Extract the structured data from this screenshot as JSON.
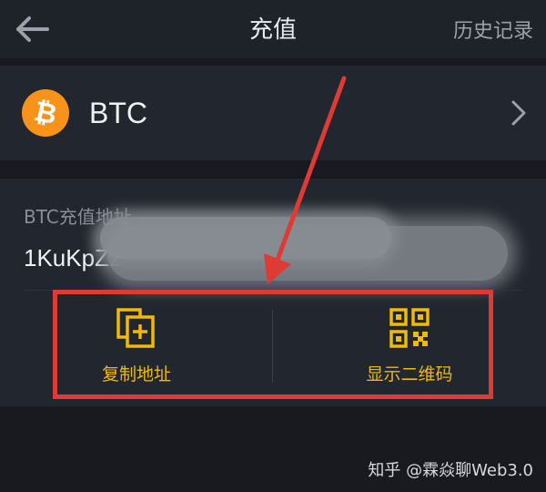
{
  "header": {
    "title": "充值",
    "history_label": "历史记录"
  },
  "coin": {
    "symbol": "BTC",
    "logo_glyph": "₿",
    "logo_color": "#f7931a"
  },
  "address": {
    "label": "BTC充值地址",
    "value_visible": "1KuKpZz"
  },
  "actions": {
    "copy_label": "复制地址",
    "qr_label": "显示二维码",
    "accent_color": "#f0b90b"
  },
  "annotation": {
    "highlight_color": "#e03a35"
  },
  "watermark": "知乎 @霖焱聊Web3.0"
}
